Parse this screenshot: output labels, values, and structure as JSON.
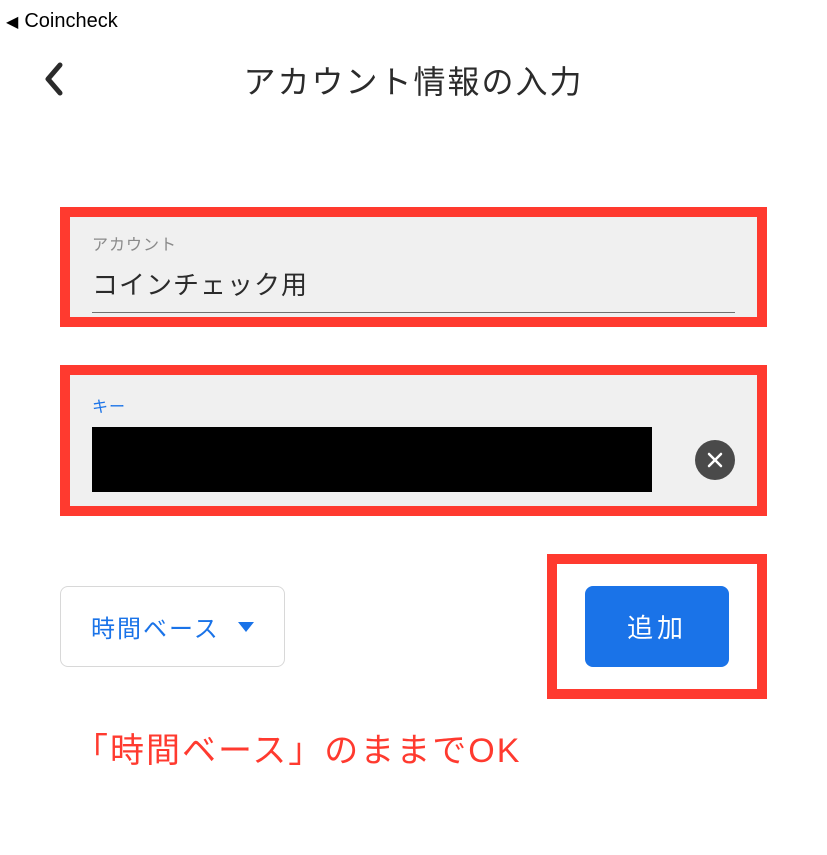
{
  "breadcrumb": {
    "label": "Coincheck"
  },
  "header": {
    "title": "アカウント情報の入力"
  },
  "fields": {
    "account": {
      "label": "アカウント",
      "value": "コインチェック用"
    },
    "key": {
      "label": "キー"
    }
  },
  "dropdown": {
    "selected": "時間ベース"
  },
  "add_button": {
    "label": "追加"
  },
  "annotation": {
    "text": "「時間ベース」のままでOK"
  },
  "colors": {
    "highlight": "#ff3a2f",
    "primary": "#1a73e8"
  }
}
